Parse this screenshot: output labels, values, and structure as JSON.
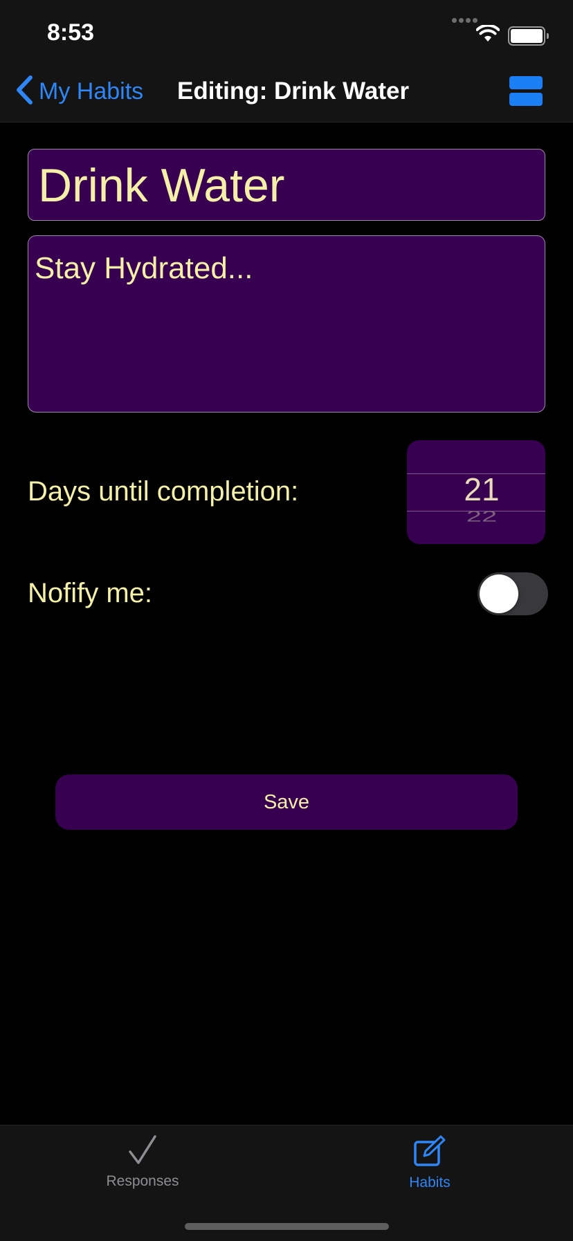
{
  "status_bar": {
    "time": "8:53"
  },
  "nav": {
    "back_label": "My Habits",
    "title": "Editing: Drink Water"
  },
  "form": {
    "name_value": "Drink Water",
    "description_value": "Stay Hydrated...",
    "days_label": "Days until completion:",
    "days_selected": "21",
    "days_next": "22",
    "notify_label": "Nofify me:",
    "notify_enabled": false,
    "save_label": "Save"
  },
  "tabs": [
    {
      "label": "Responses",
      "icon": "checkmark-icon",
      "active": false
    },
    {
      "label": "Habits",
      "icon": "edit-icon",
      "active": true
    }
  ],
  "colors": {
    "accent": "#2f86f6",
    "field_background": "#380050",
    "field_text": "#f5f0a8",
    "background": "#000000"
  }
}
